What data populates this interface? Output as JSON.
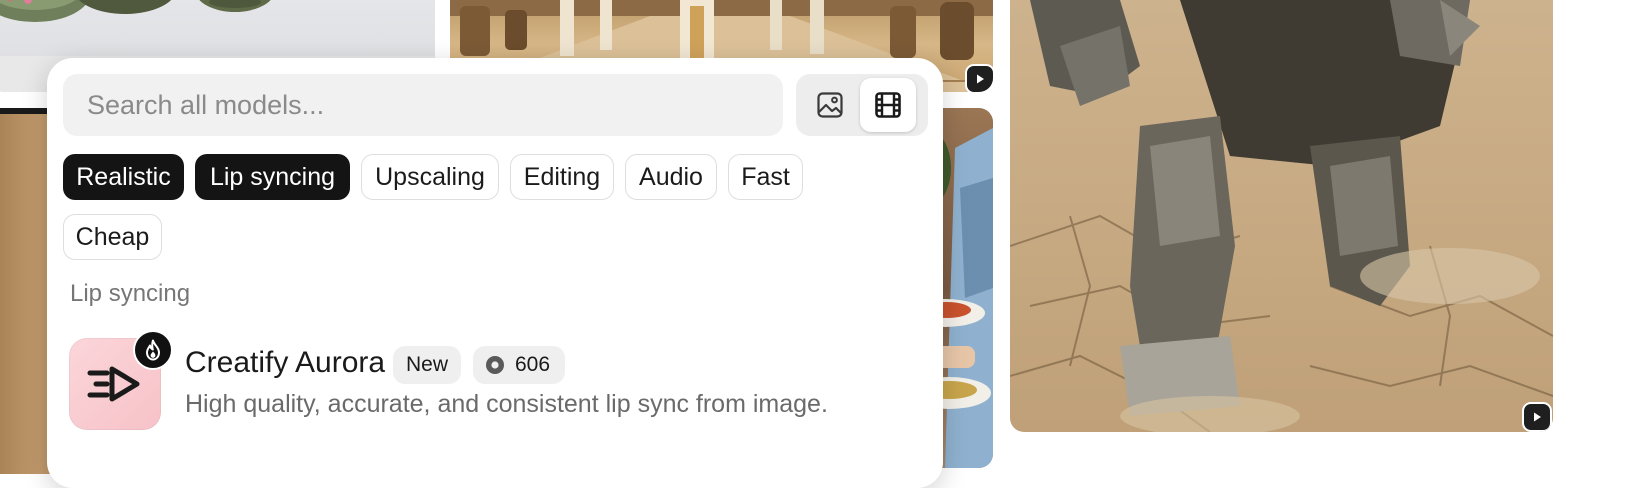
{
  "colors": {
    "accent": "#141414",
    "chip_border": "#dedede",
    "panel_bg": "#ffffff"
  },
  "background_tiles": [
    {
      "name": "crystal-spheres-image",
      "media": "image"
    },
    {
      "name": "desert-procession-video",
      "media": "video"
    },
    {
      "name": "tan-tile-image",
      "media": "image"
    },
    {
      "name": "restaurant-waiter-video",
      "media": "video"
    },
    {
      "name": "armored-knight-walking-video",
      "media": "video"
    }
  ],
  "search": {
    "placeholder": "Search all models..."
  },
  "media_toggle": {
    "options": [
      "image-icon",
      "video-icon"
    ],
    "selected": "video"
  },
  "filters": [
    {
      "label": "Realistic",
      "selected": true
    },
    {
      "label": "Lip syncing",
      "selected": true
    },
    {
      "label": "Upscaling",
      "selected": false
    },
    {
      "label": "Editing",
      "selected": false
    },
    {
      "label": "Audio",
      "selected": false
    },
    {
      "label": "Fast",
      "selected": false
    },
    {
      "label": "Cheap",
      "selected": false
    }
  ],
  "section": {
    "title": "Lip syncing"
  },
  "model": {
    "name": "Creatify Aurora",
    "badge": "New",
    "cost": "606",
    "description": "High quality, accurate, and consistent lip sync from image.",
    "icon": "creatify-logo-icon",
    "hot_icon": "flame-icon"
  }
}
